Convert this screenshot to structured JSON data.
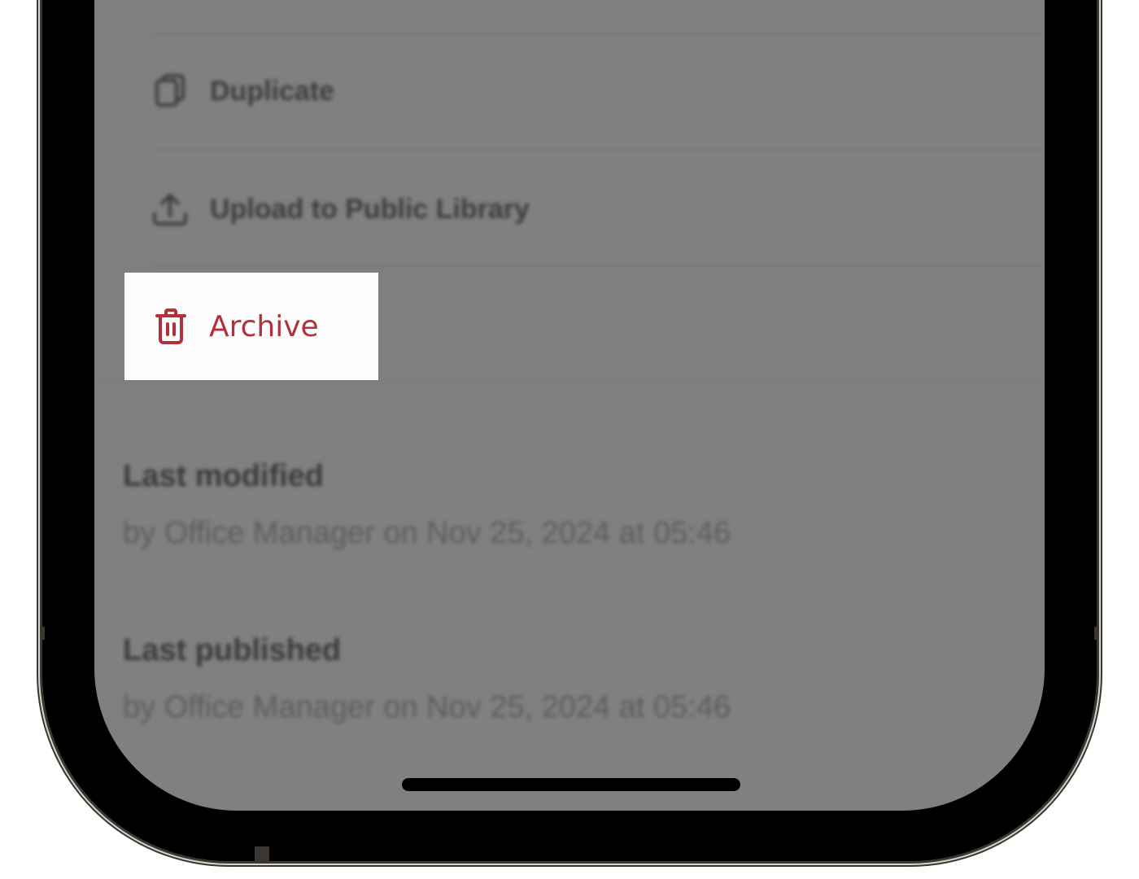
{
  "menu": {
    "duplicate_label": "Duplicate",
    "upload_label": "Upload to Public Library",
    "archive_label": "Archive"
  },
  "meta": {
    "last_modified_title": "Last modified",
    "last_modified_text": "by Office Manager on Nov 25, 2024 at 05:46",
    "last_published_title": "Last published",
    "last_published_text": "by Office Manager on Nov 25, 2024 at 05:46"
  },
  "icons": {
    "duplicate": "duplicate-icon",
    "upload": "upload-icon",
    "archive": "trash-icon"
  },
  "colors": {
    "archive_accent": "#b1323d",
    "overlay": "#808080"
  }
}
